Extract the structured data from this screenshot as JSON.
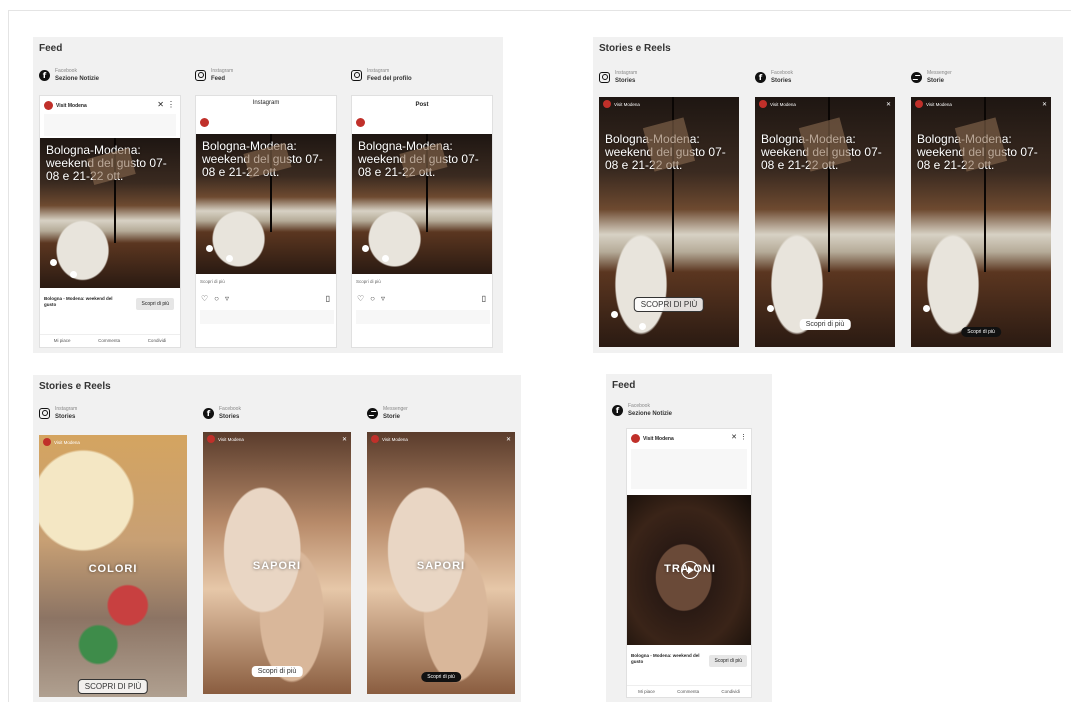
{
  "panels": {
    "p1": {
      "title": "Feed",
      "cols": [
        {
          "platform": "Facebook",
          "placement": "Sezione Notizie",
          "icon": "facebook-icon"
        },
        {
          "platform": "Instagram",
          "placement": "Feed",
          "icon": "instagram-icon"
        },
        {
          "platform": "Instagram",
          "placement": "Feed del profilo",
          "icon": "instagram-icon"
        }
      ]
    },
    "p2": {
      "title": "Stories e Reels",
      "cols": [
        {
          "platform": "Instagram",
          "placement": "Stories",
          "icon": "instagram-icon"
        },
        {
          "platform": "Facebook",
          "placement": "Stories",
          "icon": "facebook-icon"
        },
        {
          "platform": "Messenger",
          "placement": "Storie",
          "icon": "messenger-icon"
        }
      ]
    },
    "p3": {
      "title": "Stories e Reels",
      "cols": [
        {
          "platform": "Instagram",
          "placement": "Stories",
          "icon": "instagram-icon"
        },
        {
          "platform": "Facebook",
          "placement": "Stories",
          "icon": "facebook-icon"
        },
        {
          "platform": "Messenger",
          "placement": "Storie",
          "icon": "messenger-icon"
        }
      ]
    },
    "p4": {
      "title": "Feed",
      "cols": [
        {
          "platform": "Facebook",
          "placement": "Sezione Notizie",
          "icon": "facebook-icon"
        }
      ]
    }
  },
  "ad": {
    "account": "Visit Modena",
    "headline": "Bologna-Modena: weekend del gusto 07-08 e 21-22 ott.",
    "headline_short": "Bologna - Modena: weekend del gusto",
    "cta": "Scopri di più",
    "cta_caps": "SCOPRI DI PIÙ",
    "ig_header": "Instagram",
    "profile_header": "Post",
    "word_colori": "COLORI",
    "word_sapori": "SAPORI",
    "word_tradizioni": "TRA  ONI",
    "fb_actions": [
      "Mi piace",
      "Commenta",
      "Condividi"
    ]
  }
}
